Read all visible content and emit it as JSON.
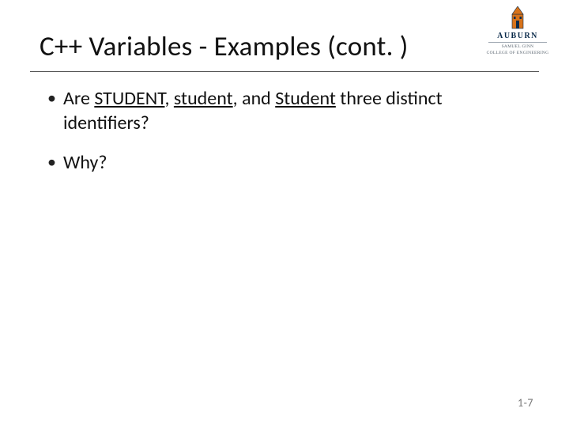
{
  "slide": {
    "title": "C++ Variables - Examples (cont. )",
    "bullets": [
      {
        "pre": "Are ",
        "u1": "STUDENT",
        "sep1": ", ",
        "u2": "student",
        "sep2": ", and ",
        "u3": "Student",
        "post": " three distinct identifiers?"
      },
      {
        "text": "Why?"
      }
    ],
    "page": "1-7"
  },
  "logo": {
    "word": "AUBURN",
    "sub1": "SAMUEL GINN",
    "sub2": "COLLEGE OF ENGINEERING"
  }
}
